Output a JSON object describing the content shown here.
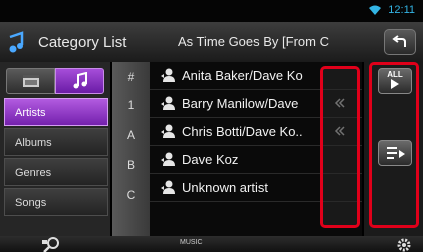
{
  "status_bar": {
    "time": "12:11",
    "wifi_icon": "wifi-icon"
  },
  "header": {
    "title": "Category List",
    "now_playing": "As Time Goes By [From C",
    "category_icon": "music-category-icon",
    "back_icon": "back-arrow-icon"
  },
  "left_panel": {
    "tabs": [
      {
        "name": "media-tab",
        "icon": "film-icon",
        "selected": false
      },
      {
        "name": "music-tab",
        "icon": "music-note-icon",
        "selected": true
      }
    ],
    "categories": [
      {
        "label": "Artists",
        "active": true
      },
      {
        "label": "Albums",
        "active": false
      },
      {
        "label": "Genres",
        "active": false
      },
      {
        "label": "Songs",
        "active": false
      }
    ]
  },
  "index": {
    "letters": [
      "#",
      "1",
      "A",
      "B",
      "C"
    ]
  },
  "list": {
    "rows": [
      {
        "label": "Anita Baker/Dave Ko",
        "icon": "person-icon",
        "flag": false
      },
      {
        "label": "Barry Manilow/Dave",
        "icon": "person-icon",
        "flag": true
      },
      {
        "label": "Chris Botti/Dave Ko..",
        "icon": "person-icon",
        "flag": true
      },
      {
        "label": "Dave Koz",
        "icon": "person-icon",
        "flag": false
      },
      {
        "label": "Unknown artist",
        "icon": "person-icon",
        "flag": false
      }
    ]
  },
  "right_panel": {
    "all_button_label": "ALL",
    "queue_icon": "playlist-play-icon"
  },
  "bottom_bar": {
    "label": "MUSIC",
    "search_icon": "search-icon",
    "settings_icon": "gear-icon"
  },
  "colors": {
    "accent_purple": "#8a2bc4",
    "highlight_red": "#e0001a",
    "clock_blue": "#33b5e5"
  }
}
